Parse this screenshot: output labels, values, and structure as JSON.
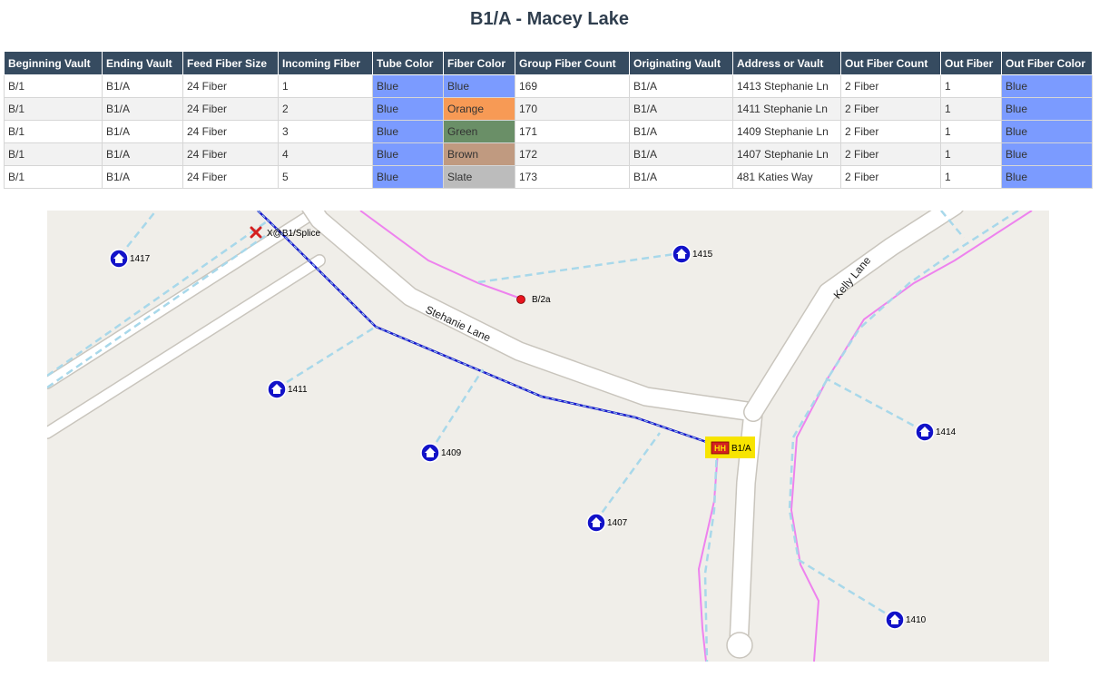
{
  "page": {
    "title": "B1/A - Macey Lake"
  },
  "table": {
    "headers": [
      "Beginning Vault",
      "Ending Vault",
      "Feed Fiber Size",
      "Incoming Fiber",
      "Tube Color",
      "Fiber Color",
      "Group Fiber Count",
      "Originating Vault",
      "Address or Vault",
      "Out Fiber Count",
      "Out Fiber",
      "Out Fiber Color"
    ],
    "rows": [
      [
        "B/1",
        "B1/A",
        "24 Fiber",
        "1",
        "Blue",
        "Blue",
        "169",
        "B1/A",
        "1413 Stephanie Ln",
        "2 Fiber",
        "1",
        "Blue"
      ],
      [
        "B/1",
        "B1/A",
        "24 Fiber",
        "2",
        "Blue",
        "Orange",
        "170",
        "B1/A",
        "1411 Stephanie Ln",
        "2 Fiber",
        "1",
        "Blue"
      ],
      [
        "B/1",
        "B1/A",
        "24 Fiber",
        "3",
        "Blue",
        "Green",
        "171",
        "B1/A",
        "1409 Stephanie Ln",
        "2 Fiber",
        "1",
        "Blue"
      ],
      [
        "B/1",
        "B1/A",
        "24 Fiber",
        "4",
        "Blue",
        "Brown",
        "172",
        "B1/A",
        "1407 Stephanie Ln",
        "2 Fiber",
        "1",
        "Blue"
      ],
      [
        "B/1",
        "B1/A",
        "24 Fiber",
        "5",
        "Blue",
        "Slate",
        "173",
        "B1/A",
        "481 Katies Way",
        "2 Fiber",
        "1",
        "Blue"
      ]
    ],
    "color_swatches": {
      "Blue": "#7b9bff",
      "Orange": "#f79a55",
      "Green": "#6a8f67",
      "Brown": "#c09a80",
      "Slate": "#bcbcbc"
    }
  },
  "map": {
    "roads": {
      "stehanie": "Stehanie Lane",
      "kelly": "Kelly Lane"
    },
    "splice_label": "X@B1/Splice",
    "vault_b2a_label": "B/2a",
    "handhole": {
      "badge": "HH",
      "label": "B1/A",
      "highlight": "#f7e400"
    },
    "houses": [
      {
        "label": "1417"
      },
      {
        "label": "1415"
      },
      {
        "label": "1411"
      },
      {
        "label": "1409"
      },
      {
        "label": "1407"
      },
      {
        "label": "1414"
      },
      {
        "label": "1410"
      }
    ],
    "colors": {
      "background": "#f0eee9",
      "road": "#ffffff",
      "drop": "#a8d8ea",
      "feeder": "#1a1acc",
      "pink": "#ee82ee",
      "house": "#1212c8",
      "vault_dot": "#e8141e",
      "splice": "#d42020"
    }
  }
}
